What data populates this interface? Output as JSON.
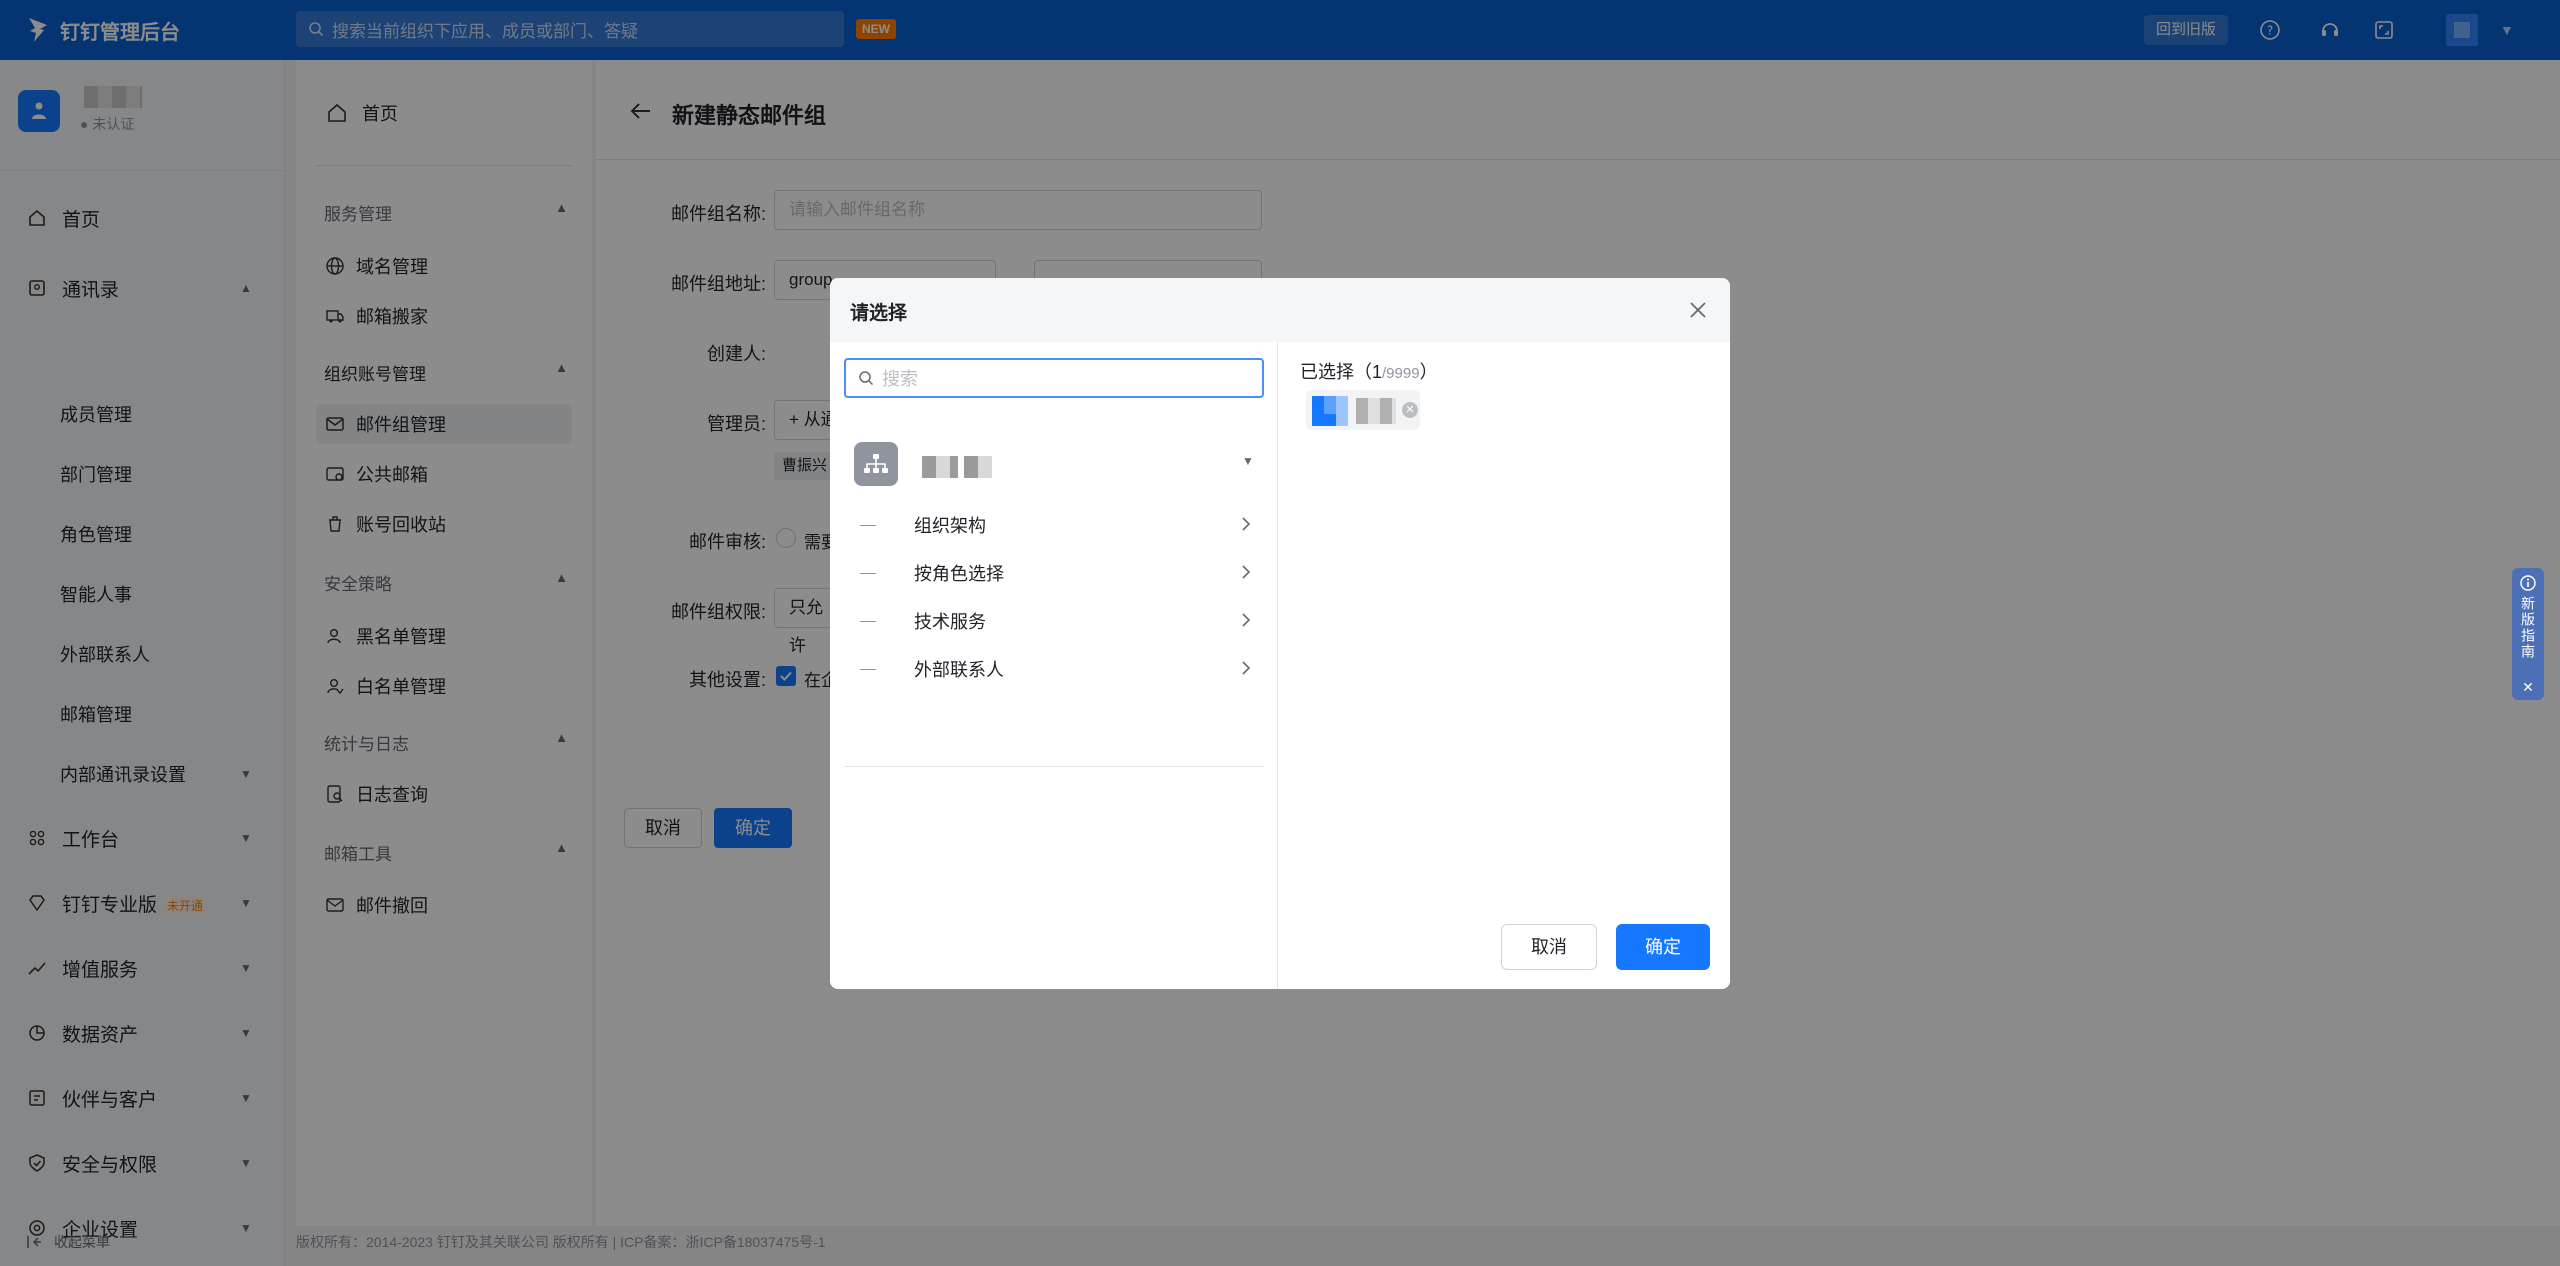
{
  "topbar": {
    "brand": "钉钉管理后台",
    "search_placeholder": "搜索当前组织下应用、成员或部门、答疑",
    "new_badge": "NEW",
    "back_old": "回到旧版"
  },
  "sidebar": {
    "org_cert": "未认证",
    "items": [
      {
        "label": "首页",
        "icon": "home-icon"
      },
      {
        "label": "通讯录",
        "icon": "contacts-icon"
      },
      {
        "label": "成员管理"
      },
      {
        "label": "部门管理"
      },
      {
        "label": "角色管理"
      },
      {
        "label": "智能人事"
      },
      {
        "label": "外部联系人"
      },
      {
        "label": "邮箱管理"
      },
      {
        "label": "内部通讯录设置"
      },
      {
        "label": "工作台",
        "icon": "apps-icon"
      },
      {
        "label": "钉钉专业版",
        "icon": "diamond-icon",
        "badge": "未开通"
      },
      {
        "label": "增值服务",
        "icon": "trend-icon"
      },
      {
        "label": "数据资产",
        "icon": "data-icon"
      },
      {
        "label": "伙伴与客户",
        "icon": "partner-icon"
      },
      {
        "label": "安全与权限",
        "icon": "shield-icon"
      },
      {
        "label": "企业设置",
        "icon": "settings-icon"
      }
    ],
    "collapse": "收起菜单"
  },
  "submenu": {
    "home": "首页",
    "groups": [
      {
        "title": "服务管理",
        "items": [
          "域名管理",
          "邮箱搬家"
        ]
      },
      {
        "title": "组织账号管理",
        "items": [
          "邮件组管理",
          "公共邮箱",
          "账号回收站"
        ]
      },
      {
        "title": "安全策略",
        "items": [
          "黑名单管理",
          "白名单管理"
        ]
      },
      {
        "title": "统计与日志",
        "items": [
          "日志查询"
        ]
      },
      {
        "title": "邮箱工具",
        "items": [
          "邮件撤回"
        ]
      }
    ]
  },
  "main": {
    "title": "新建静态邮件组",
    "form": {
      "name_label": "邮件组名称:",
      "name_placeholder": "请输入邮件组名称",
      "address_label": "邮件组地址:",
      "address_value": "group",
      "creator_label": "创建人:",
      "admin_label": "管理员:",
      "admin_add": "+ 从通",
      "admin_tag": "曹振兴",
      "review_label": "邮件审核:",
      "review_option": "需要",
      "permission_label": "邮件组权限:",
      "permission_value": "只允许",
      "other_label": "其他设置:",
      "other_option": "在企",
      "cancel": "取消",
      "confirm": "确定"
    }
  },
  "footer": {
    "copyright": "版权所有：2014-2023 钉钉及其关联公司 版权所有 | ICP备案：浙ICP备18037475号-1"
  },
  "modal": {
    "title": "请选择",
    "search_placeholder": "搜索",
    "departments": [
      "组织架构",
      "按角色选择",
      "技术服务",
      "外部联系人"
    ],
    "selected_label": "已选择（",
    "selected_count": "1",
    "selected_max": "/9999",
    "selected_close": "）",
    "cancel": "取消",
    "confirm": "确定"
  },
  "guide": {
    "label": "新版指南"
  },
  "colors": {
    "brand_blue": "#0a5fcf",
    "primary": "#1677ff",
    "badge_orange": "#ff7d00"
  }
}
